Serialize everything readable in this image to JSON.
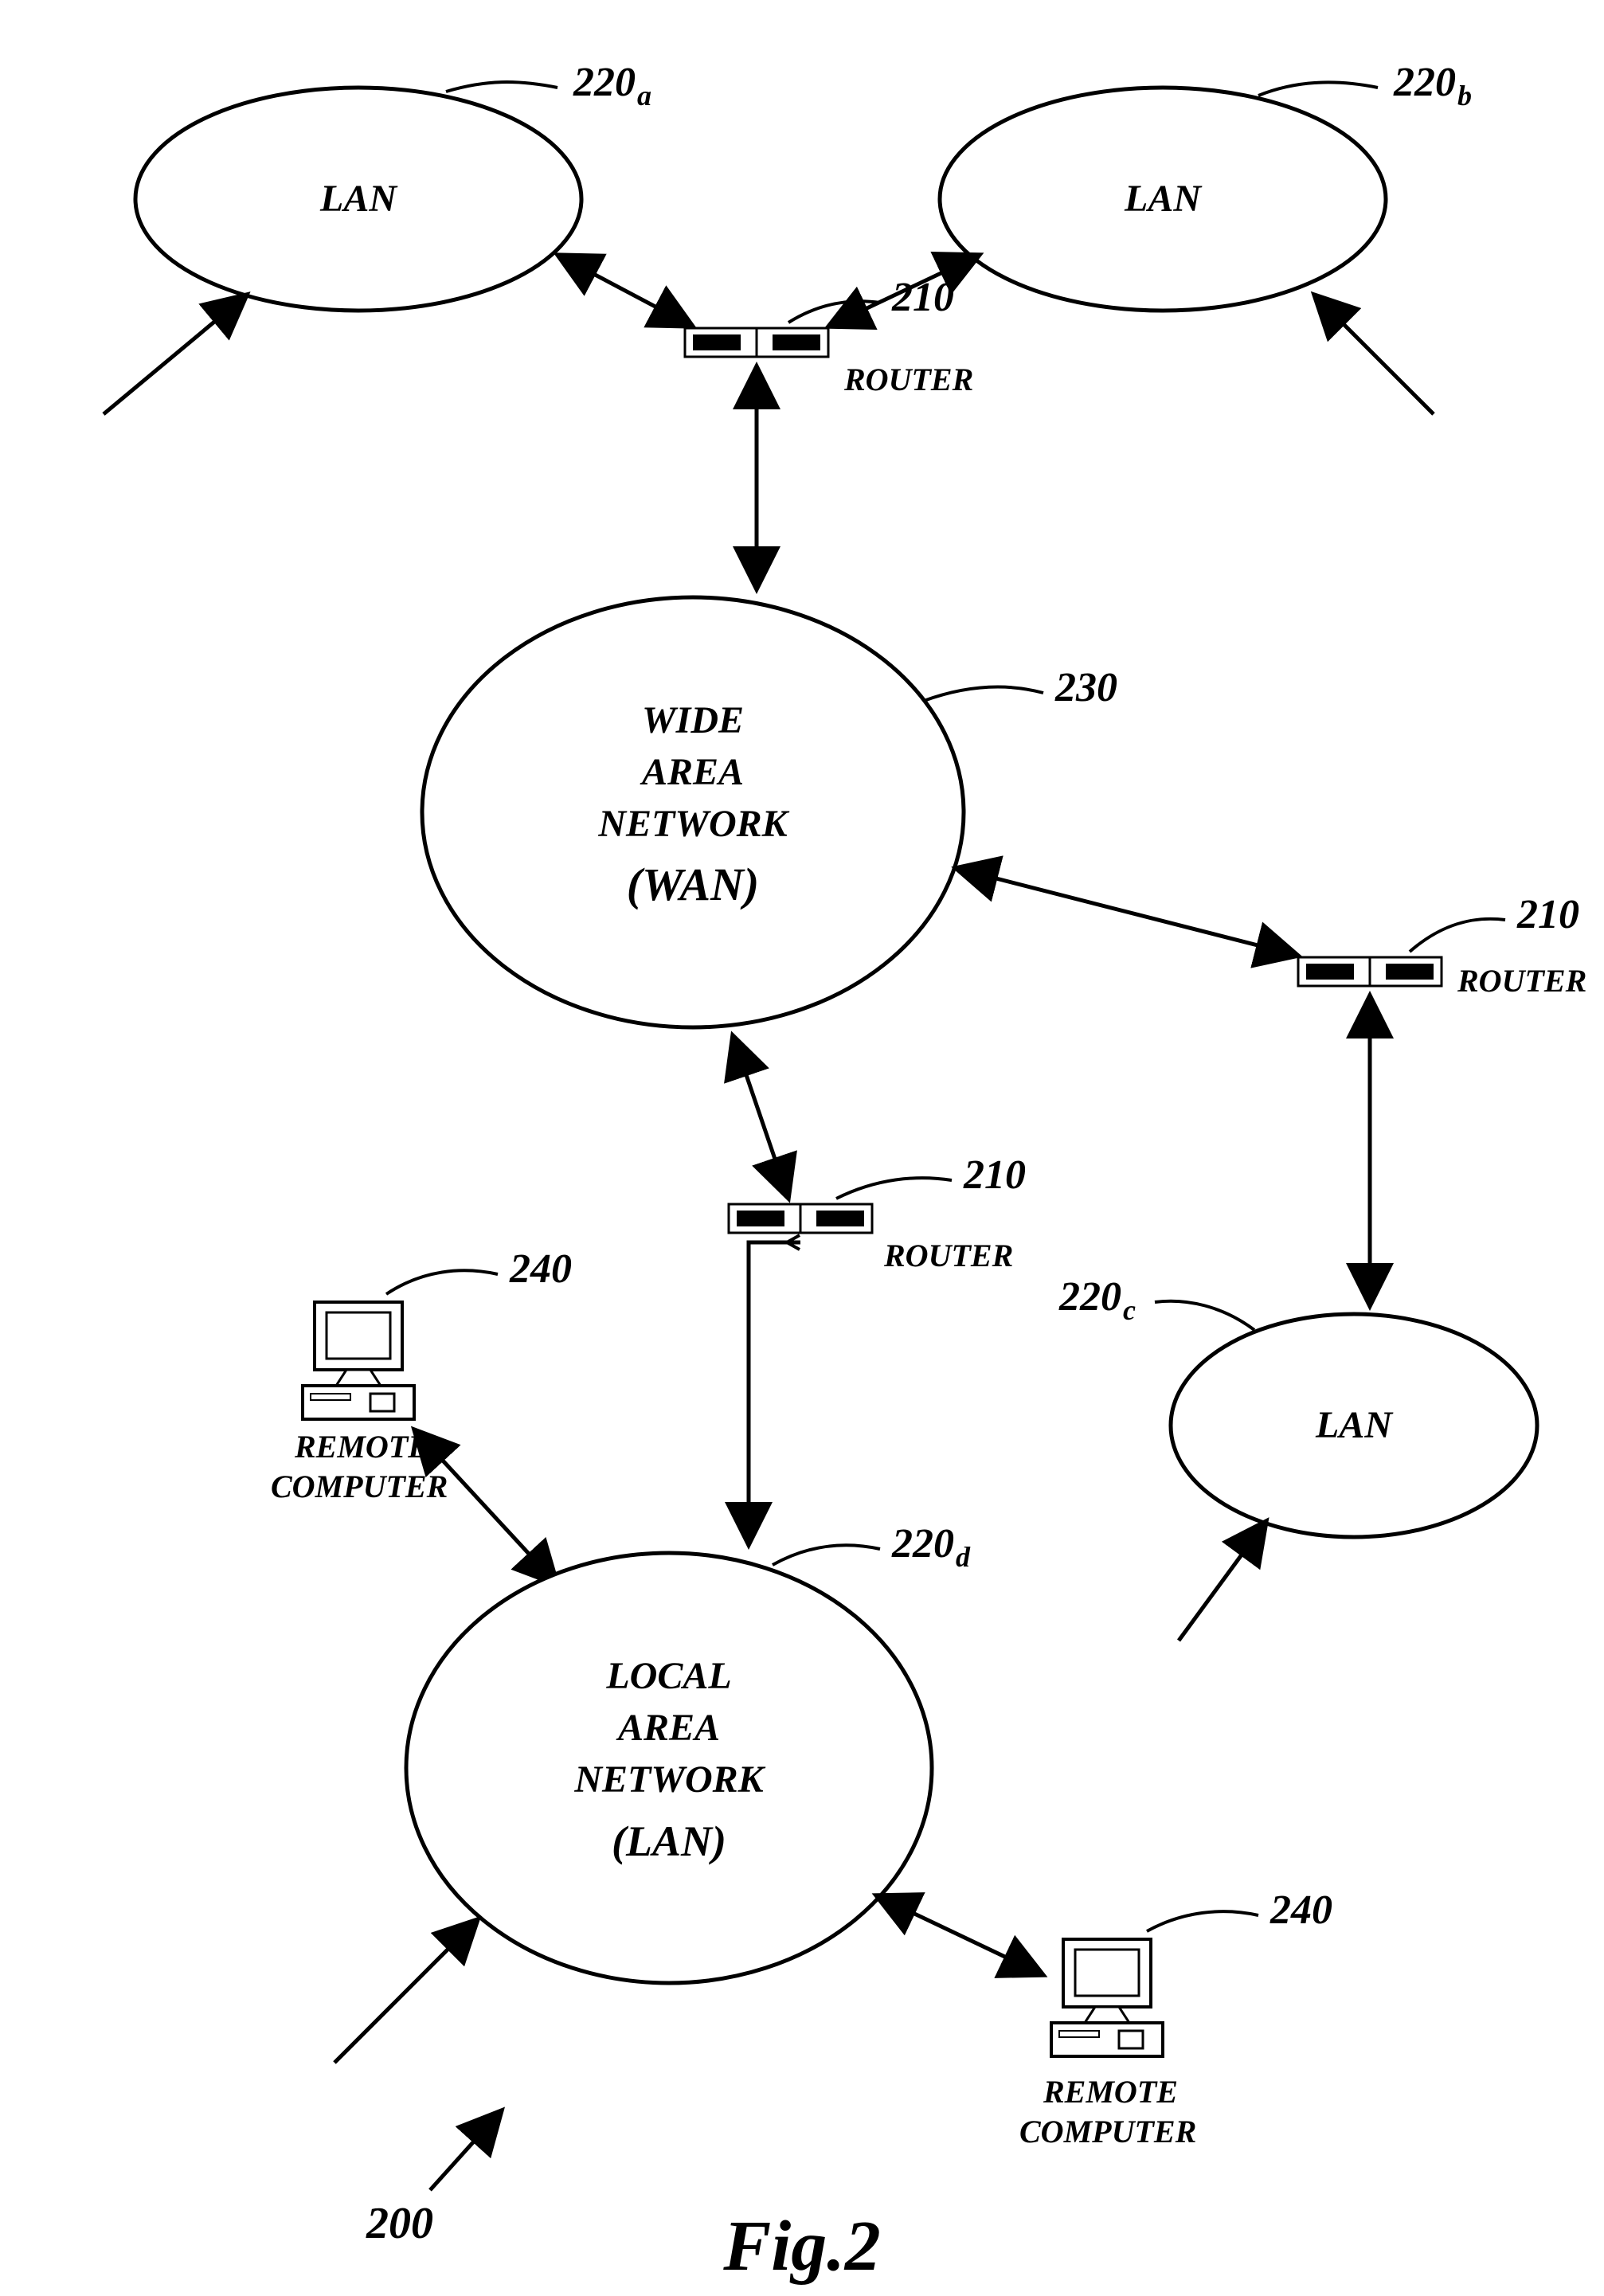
{
  "labels": {
    "lan_a": "LAN",
    "lan_b": "LAN",
    "lan_c": "LAN",
    "lan_d_line1": "LOCAL",
    "lan_d_line2": "AREA",
    "lan_d_line3": "NETWORK",
    "lan_d_line4": "(LAN)",
    "wan_line1": "WIDE",
    "wan_line2": "AREA",
    "wan_line3": "NETWORK",
    "wan_line4": "(WAN)",
    "router": "ROUTER",
    "remote1": "REMOTE",
    "remote2": "COMPUTER",
    "fig": "Fig.2"
  },
  "refs": {
    "r200": "200",
    "r210": "210",
    "r220a": "220",
    "r220a_sub": "a",
    "r220b": "220",
    "r220b_sub": "b",
    "r220c": "220",
    "r220c_sub": "c",
    "r220d": "220",
    "r220d_sub": "d",
    "r230": "230",
    "r240": "240"
  }
}
